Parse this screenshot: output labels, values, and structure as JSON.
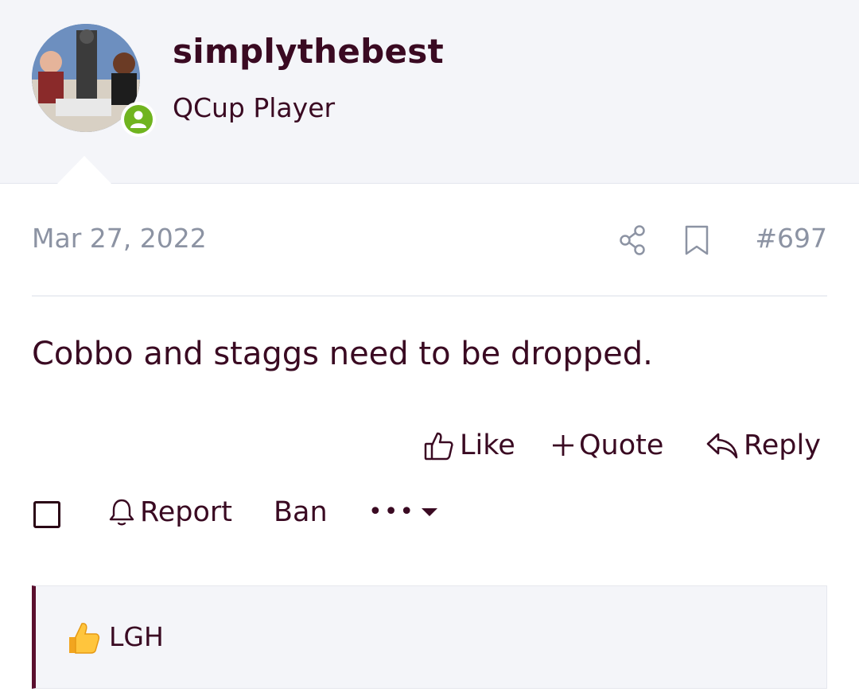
{
  "user": {
    "username": "simplythebest",
    "title": "QCup Player",
    "avatar_icon": "avatar-photo",
    "status_icon": "online-user-icon",
    "status_color": "#70b41f"
  },
  "post": {
    "date": "Mar 27, 2022",
    "number": "#697",
    "share_icon": "share-icon",
    "bookmark_icon": "bookmark-icon",
    "body": "Cobbo and staggs need to be dropped."
  },
  "actions": {
    "like_label": "Like",
    "quote_label": "Quote",
    "reply_label": "Reply",
    "report_label": "Report",
    "ban_label": "Ban",
    "more_label": "•••"
  },
  "reactions": {
    "emoji": "👍",
    "users": "LGH"
  },
  "colors": {
    "text": "#3a0a22",
    "muted": "#8c93a3",
    "header_bg": "#f4f5f9",
    "accent": "#5a0f2e"
  }
}
